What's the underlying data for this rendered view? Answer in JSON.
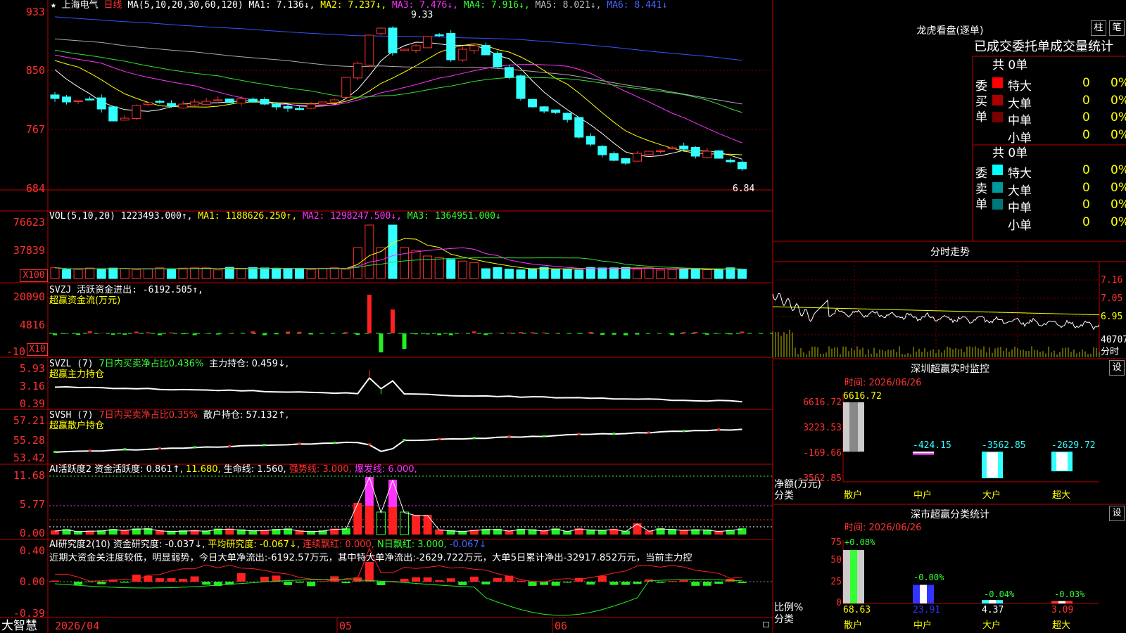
{
  "price_panel": {
    "star": "★",
    "stock_name": "上海电气",
    "period": "日线",
    "ma_header": "MA(5,10,20,30,60,120)",
    "ma1": "MA1: 7.136↓,",
    "ma2": "MA2: 7.237↓,",
    "ma3": "MA3: 7.476↓,",
    "ma4": "MA4: 7.916↓,",
    "ma5": "MA5: 8.021↓,",
    "ma6": "MA6: 8.441↓",
    "y_ticks": [
      "933",
      "850",
      "767",
      "684"
    ],
    "high_label": "9.33",
    "low_label": "6.84"
  },
  "vol_panel": {
    "header": "VOL(5,10,20)",
    "value": "1223493.000↑,",
    "ma1": "MA1: 1188626.250↑,",
    "ma2": "MA2: 1298247.500↓,",
    "ma3": "MA3: 1364951.000↓",
    "y_ticks": [
      "76623",
      "37839"
    ],
    "unit": "X100"
  },
  "svzj_panel": {
    "header": "SVZJ  活跃资金进出: -6192.505↑,",
    "subtitle": "超赢资金流(万元)",
    "y_ticks": [
      "20090",
      "4816",
      "-10"
    ],
    "unit": "X10"
  },
  "svzl_panel": {
    "header": "SVZL (7)",
    "green_text": "7日内买卖净占比0.436%",
    "main_hold": "主力持仓: 0.459↓,",
    "subtitle": "超赢主力持仓",
    "y_ticks": [
      "5.93",
      "3.16",
      "0.39"
    ]
  },
  "svsh_panel": {
    "header": "SVSH (7)",
    "red_text": "7日内买卖净占比0.35%",
    "retail_hold": "散户持仓: 57.132↑,",
    "subtitle": "超赢散户持仓",
    "y_ticks": [
      "57.21",
      "55.28",
      "53.42"
    ]
  },
  "ai_active_panel": {
    "header": "AI活跃度2 资金活跃度: 0.861↑,",
    "v2": "11.680,",
    "life": "生命线: 1.560,",
    "strong": "强势线: 3.000,",
    "burst": "爆发线: 6.000,",
    "y_ticks": [
      "11.68",
      "5.77",
      "0.00"
    ]
  },
  "ai_research_panel": {
    "header": "AI研究度2(10) 资金研究度: -0.037↓,",
    "avg": "平均研究度: -0.067↓,",
    "streak": "连续飘红: 0.000,",
    "nday": "N日飘红: 3.000,",
    "last": "-0.067↓",
    "comment": "近期大资金关注度较低，明显弱势，今日大单净流出:-6192.57万元，其中特大单净流出:-2629.722万元，大单5日累计净出-32917.852万元，当前主力控",
    "y_ticks": [
      "0.40",
      "0.00",
      "-0.39"
    ]
  },
  "footer": {
    "logo": "大智慧",
    "dates": [
      "2026/04",
      "05",
      "06"
    ]
  },
  "dragon_tiger": {
    "title": "龙虎看盘(逐单)",
    "btn1": "柱",
    "btn2": "笔",
    "tabs": "已成交委托单成交量统计",
    "buy_label": "委买单",
    "sell_label": "委卖单",
    "buy_total": "共 0单",
    "sell_total": "共 0单",
    "buy_rows": [
      {
        "name": "特大",
        "count": "0",
        "pct": "0%",
        "color": "#ff0000"
      },
      {
        "name": "大单",
        "count": "0",
        "pct": "0%",
        "color": "#aa0000"
      },
      {
        "name": "中单",
        "count": "0",
        "pct": "0%",
        "color": "#770000"
      },
      {
        "name": "小单",
        "count": "0",
        "pct": "0%",
        "color": "#000000"
      }
    ],
    "sell_rows": [
      {
        "name": "特大",
        "count": "0",
        "pct": "0%",
        "color": "#00ffff"
      },
      {
        "name": "大单",
        "count": "0",
        "pct": "0%",
        "color": "#009999"
      },
      {
        "name": "中单",
        "count": "0",
        "pct": "0%",
        "color": "#007777"
      },
      {
        "name": "小单",
        "count": "0",
        "pct": "0%",
        "color": "#000000"
      }
    ]
  },
  "intraday": {
    "title": "分时走势",
    "y_ticks": [
      "7.16",
      "7.05",
      "6.95"
    ],
    "vol_tick": "40707",
    "vol_label": "分时"
  },
  "sz_monitor": {
    "title": "深圳超赢实时监控",
    "btn": "设",
    "time": "时间: 2026/06/26",
    "y_ticks": [
      "6616.72",
      "3223.53",
      "-169.66",
      "-3562.85"
    ],
    "y_label": "净额(万元)",
    "x_label": "分类",
    "bar_labels": [
      "6616.72",
      "-424.15",
      "-3562.85",
      "-2629.72"
    ],
    "categories": [
      "散户",
      "中户",
      "大户",
      "超大"
    ]
  },
  "sz_classify": {
    "title": "深市超赢分类统计",
    "btn": "设",
    "time": "时间: 2026/06/26",
    "y_ticks": [
      "75",
      "50",
      "25",
      "0"
    ],
    "y_label": "比例%",
    "x_label": "分类",
    "top_labels": [
      "+0.08%",
      "-0.00%",
      "-0.04%",
      "-0.03%"
    ],
    "bottom_labels": [
      "68.63",
      "23.91",
      "4.37",
      "3.09"
    ],
    "categories": [
      "散户",
      "中户",
      "大户",
      "超大"
    ]
  },
  "chart_data": {
    "type": "bar",
    "title": "深圳超赢实时监控",
    "ylabel": "净额(万元)",
    "xlabel": "分类",
    "categories": [
      "散户",
      "中户",
      "大户",
      "超大"
    ],
    "values": [
      6616.72,
      -424.15,
      -3562.85,
      -2629.72
    ],
    "ylim": [
      -3562.85,
      6616.72
    ]
  }
}
